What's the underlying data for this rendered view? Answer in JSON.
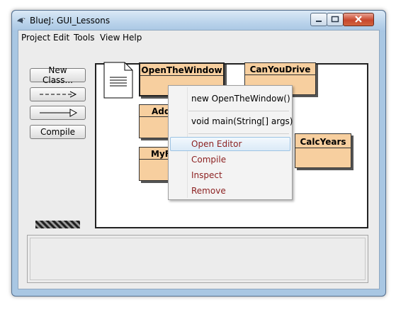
{
  "window": {
    "title": "BlueJ:  GUI_Lessons",
    "controls": [
      "minimize-icon",
      "maximize-icon",
      "close-icon"
    ]
  },
  "menubar": [
    "Project",
    "Edit",
    "Tools",
    "View",
    "Help"
  ],
  "toolbar": {
    "new_class_label": "New Class...",
    "uses_arrow": "dashed-arrow-icon",
    "inherits_arrow": "inheritance-arrow-icon",
    "compile_label": "Compile"
  },
  "classes": {
    "open_the_window": "OpenTheWindow",
    "can_you_drive": "CanYouDrive",
    "add": "Add",
    "calc_years": "CalcYears",
    "my_first": "MyFi"
  },
  "context_menu": {
    "new_object": "new OpenTheWindow()",
    "main_method": "void main(String[] args)",
    "open_editor": "Open Editor",
    "compile": "Compile",
    "inspect": "Inspect",
    "remove": "Remove"
  },
  "colors": {
    "class_fill": "#f7cf9f",
    "menu_edit_text": "#8b1f1f",
    "title_bar": "#b8d2ea"
  }
}
